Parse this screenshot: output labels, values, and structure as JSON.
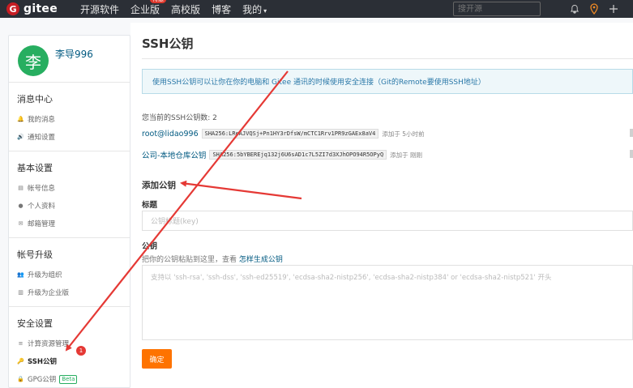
{
  "topbar": {
    "logo_mark": "G",
    "logo_text": "gitee",
    "nav": [
      {
        "label": "开源软件"
      },
      {
        "label": "企业版",
        "badge": "特惠"
      },
      {
        "label": "高校版"
      },
      {
        "label": "博客"
      },
      {
        "label": "我的"
      }
    ],
    "caret": "▾",
    "search_placeholder": "搜开源",
    "icons": [
      "bell-icon",
      "location-pin-icon",
      "plus-icon"
    ]
  },
  "sidebar": {
    "avatar_char": "李",
    "username": "李导996",
    "sections": [
      {
        "title": "消息中心",
        "items": [
          {
            "icon": "bell-icon",
            "glyph": "🔔",
            "label": "我的消息"
          },
          {
            "icon": "speaker-icon",
            "glyph": "🔊",
            "label": "通知设置"
          }
        ]
      },
      {
        "title": "基本设置",
        "items": [
          {
            "icon": "id-card-icon",
            "glyph": "▤",
            "label": "帐号信息"
          },
          {
            "icon": "user-icon",
            "glyph": "●",
            "label": "个人资料"
          },
          {
            "icon": "envelope-icon",
            "glyph": "✉",
            "label": "邮箱管理"
          }
        ]
      },
      {
        "title": "帐号升级",
        "items": [
          {
            "icon": "group-icon",
            "glyph": "👥",
            "label": "升级为组织"
          },
          {
            "icon": "building-icon",
            "glyph": "▥",
            "label": "升级为企业版"
          }
        ]
      },
      {
        "title": "安全设置",
        "items": [
          {
            "icon": "list-icon",
            "glyph": "≡",
            "label": "计算资源管理"
          },
          {
            "icon": "key-icon",
            "glyph": "🔑",
            "label": "SSH公钥",
            "active": true
          },
          {
            "icon": "lock-icon",
            "glyph": "🔒",
            "label": "GPG公钥",
            "badge": "Beta"
          }
        ]
      }
    ]
  },
  "main": {
    "title": "SSH公钥",
    "info": "使用SSH公钥可以让你在你的电脑和 Gitee 通讯的时候使用安全连接（Git的Remote要使用SSH地址）",
    "key_count": "您当前的SSH公钥数: 2",
    "keys": [
      {
        "name": "root@lidao996",
        "fingerprint": "SHA256:LReAJVQSj+Pn1HY3rDfsW/mCTC1Rrv1PR9zGAEx8aV4",
        "time": "添加于 5小时前"
      },
      {
        "name": "公司-本地仓库公钥",
        "fingerprint": "SHA256:5bYBEREjq132j6U6sAD1c7L5ZI7d3XJhOPO94R5OPyQ",
        "time": "添加于 刚刚"
      }
    ],
    "add_title": "添加公钥",
    "title_label": "标题",
    "title_placeholder": "公钥标题(key)",
    "key_label": "公钥",
    "hint_text": "把你的公钥粘贴到这里，查看",
    "hint_link": "怎样生成公钥",
    "key_placeholder": "支持以 'ssh-rsa', 'ssh-dss', 'ssh-ed25519', 'ecdsa-sha2-nistp256', 'ecdsa-sha2-nistp384' or 'ecdsa-sha2-nistp521' 开头",
    "confirm_label": "确定"
  },
  "annotation": {
    "badge": "1",
    "color": "#e53935"
  }
}
